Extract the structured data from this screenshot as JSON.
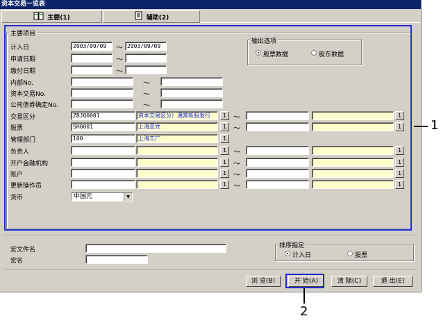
{
  "window": {
    "title": "资本交易一览表"
  },
  "tabs": [
    {
      "label": "主要(1)",
      "icon": "book-icon"
    },
    {
      "label": "辅助(2)",
      "icon": "notepad-icon"
    }
  ],
  "main_group": {
    "title": "主要项目"
  },
  "output_options": {
    "title": "输出选项",
    "options": [
      {
        "label": "股票数据",
        "selected": true
      },
      {
        "label": "股东数据",
        "selected": false
      }
    ]
  },
  "date_rows": [
    {
      "label": "计入日",
      "from": "2003/09/09",
      "to": "2003/09/09"
    },
    {
      "label": "申请日期",
      "from": "",
      "to": ""
    },
    {
      "label": "缴付日期",
      "from": "",
      "to": ""
    }
  ],
  "range_rows": [
    {
      "label": "内部No.",
      "from": "",
      "to": ""
    },
    {
      "label": "资本交易No.",
      "from": "",
      "to": ""
    },
    {
      "label": "公司债券确定No.",
      "from": "",
      "to": ""
    }
  ],
  "lookup_rows": [
    {
      "label": "交易区分",
      "code": "ZBJQ0001",
      "name": "资本交易区分）通常新股发行",
      "to_code": "",
      "to_name": "",
      "range": true
    },
    {
      "label": "股票",
      "code": "SH0001",
      "name": "上海亚龙",
      "to_code": "",
      "to_name": "",
      "range": true
    },
    {
      "label": "管理部门",
      "code": "100",
      "name": "上海工厂",
      "range": false
    },
    {
      "label": "负责人",
      "code": "",
      "name": "",
      "to_code": "",
      "to_name": "",
      "range": true
    },
    {
      "label": "开户金融机构",
      "code": "",
      "name": "",
      "to_code": "",
      "to_name": "",
      "range": true
    },
    {
      "label": "账户",
      "code": "",
      "name": "",
      "to_code": "",
      "to_name": "",
      "range": true
    },
    {
      "label": "更新操作员",
      "code": "",
      "name": "",
      "to_code": "",
      "to_name": "",
      "range": true
    }
  ],
  "currency": {
    "label": "货币",
    "value": "中国元"
  },
  "lookup_button_label": "1",
  "tilde": "～",
  "macro": {
    "file_label": "宏文件名",
    "file_value": "",
    "name_label": "宏名",
    "name_value": ""
  },
  "sort": {
    "title": "排序指定",
    "options": [
      {
        "label": "计入日",
        "selected": true
      },
      {
        "label": "股票",
        "selected": false
      }
    ]
  },
  "buttons": {
    "browse": "浏 览(B)",
    "start": "开 始(A)",
    "clear": "清 除(C)",
    "exit": "退 出(E)"
  },
  "callouts": {
    "one": "1",
    "two": "2"
  },
  "colors": {
    "title_bar": "#0a246a",
    "highlight_border": "#1f2bd0",
    "name_field": "#ffffcc",
    "face": "#d4d0c8"
  }
}
